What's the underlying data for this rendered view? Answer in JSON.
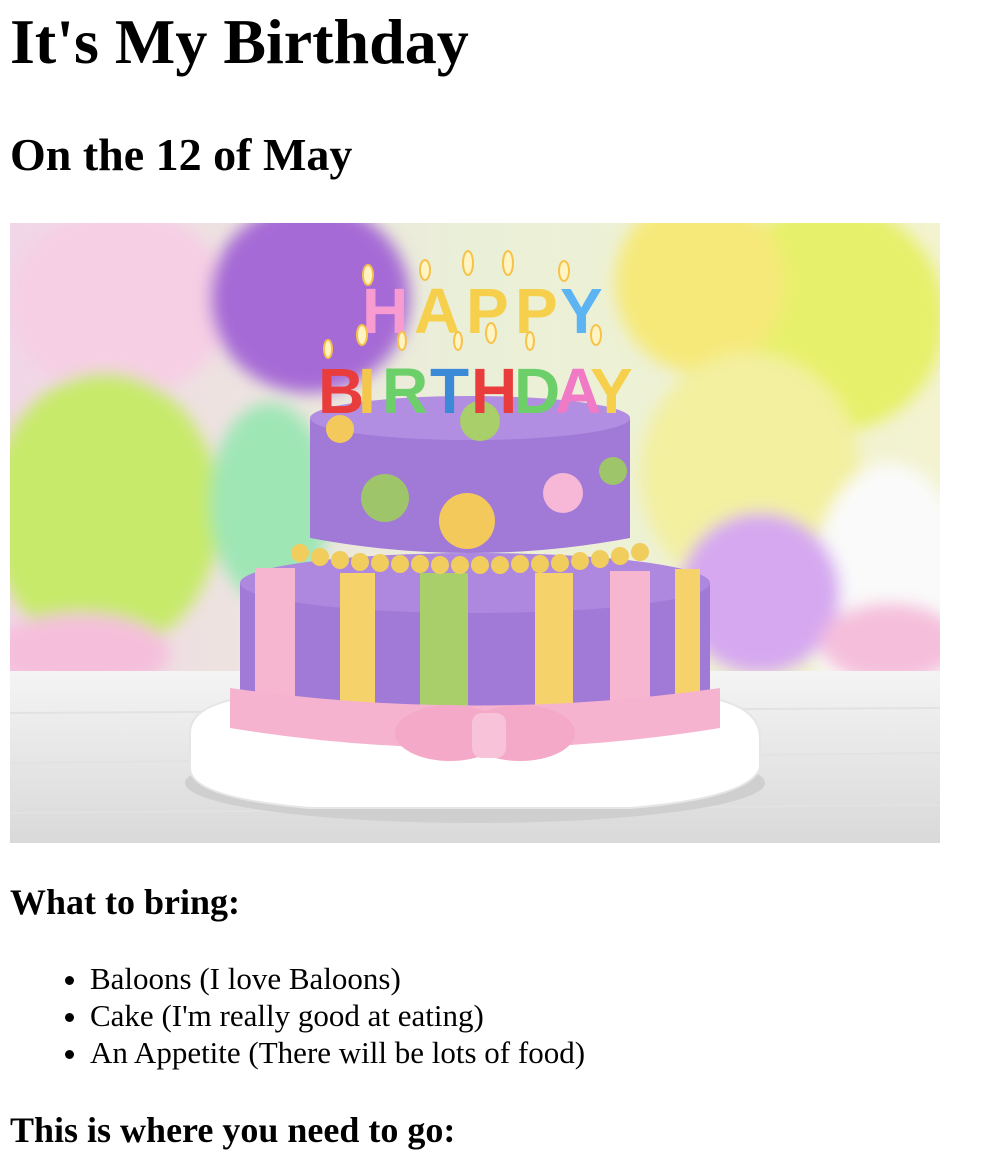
{
  "page": {
    "title": "It's My Birthday",
    "date_heading": "On the 12 of May",
    "hero_image": {
      "alt": "Two-tier purple birthday cake with HAPPY BIRTHDAY candles",
      "candle_top_text": "HAPPY",
      "candle_bottom_text": "BIRTHDAY"
    },
    "bring_heading": "What to bring:",
    "bring_items": [
      "Baloons (I love Baloons)",
      "Cake (I'm really good at eating)",
      "An Appetite (There will be lots of food)"
    ],
    "directions_heading": "This is where you need to go:"
  },
  "colors": {
    "text": "#000000",
    "background": "#ffffff"
  }
}
